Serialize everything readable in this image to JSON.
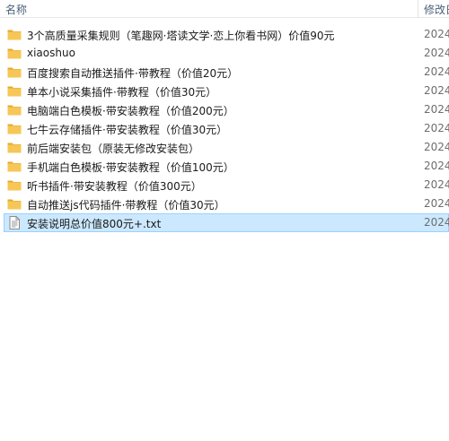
{
  "columns": {
    "name": "名称",
    "date": "修改日期"
  },
  "items": [
    {
      "name": "3个高质量采集规则（笔趣网·塔读文学·恋上你看书网）价值90元",
      "type": "folder",
      "date": "2024"
    },
    {
      "name": "xiaoshuo",
      "type": "folder",
      "date": "2024"
    },
    {
      "name": "百度搜索自动推送插件·带教程（价值20元）",
      "type": "folder",
      "date": "2024"
    },
    {
      "name": "单本小说采集插件·带教程（价值30元）",
      "type": "folder",
      "date": "2024"
    },
    {
      "name": "电脑端白色模板·带安装教程（价值200元）",
      "type": "folder",
      "date": "2024"
    },
    {
      "name": "七牛云存储插件·带安装教程（价值30元）",
      "type": "folder",
      "date": "2024"
    },
    {
      "name": "前后端安装包（原装无修改安装包）",
      "type": "folder",
      "date": "2024"
    },
    {
      "name": "手机端白色模板·带安装教程（价值100元）",
      "type": "folder",
      "date": "2024"
    },
    {
      "name": "听书插件·带安装教程（价值300元）",
      "type": "folder",
      "date": "2024"
    },
    {
      "name": "自动推送js代码插件·带教程（价值30元）",
      "type": "folder",
      "date": "2024"
    },
    {
      "name": "安装说明总价值800元+.txt",
      "type": "text-file",
      "date": "2024",
      "selected": true
    }
  ],
  "colors": {
    "folder": "#f6c757",
    "folder_dark": "#e4a92c",
    "selection_bg": "#cce8ff",
    "selection_border": "#99d1ff",
    "header_text": "#4c607a"
  }
}
